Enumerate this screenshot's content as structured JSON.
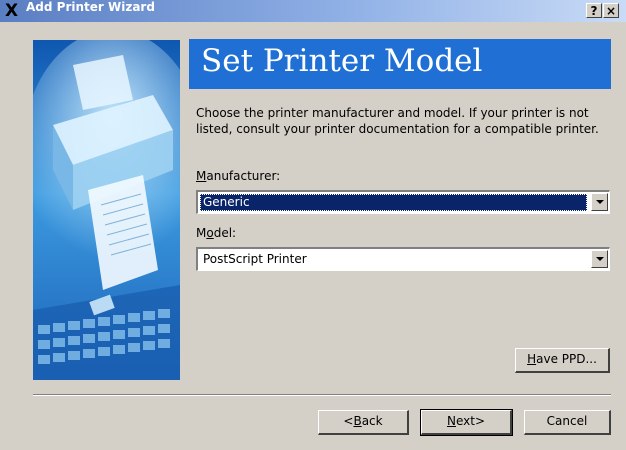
{
  "window": {
    "title": "Add Printer Wizard",
    "help_button": "?",
    "close_button": "×"
  },
  "page": {
    "title": "Set Printer Model",
    "description": "Choose the printer manufacturer and model. If your printer is not listed, consult your printer documentation for a compatible printer."
  },
  "manufacturer": {
    "label_prefix": "",
    "label_key": "M",
    "label_rest": "anufacturer:",
    "value": "Generic"
  },
  "model": {
    "label_prefix": "M",
    "label_key": "o",
    "label_rest": "del:",
    "value": "PostScript Printer"
  },
  "buttons": {
    "have_ppd_key": "H",
    "have_ppd_rest": "ave PPD...",
    "back_prefix": "<",
    "back_key": "B",
    "back_rest": "ack",
    "next_prefix": "",
    "next_key": "N",
    "next_rest": "ext>",
    "cancel": "Cancel"
  },
  "colors": {
    "header_band": "#1f6fd4",
    "selection": "#0a246a",
    "dialog_bg": "#d4d0c8"
  }
}
